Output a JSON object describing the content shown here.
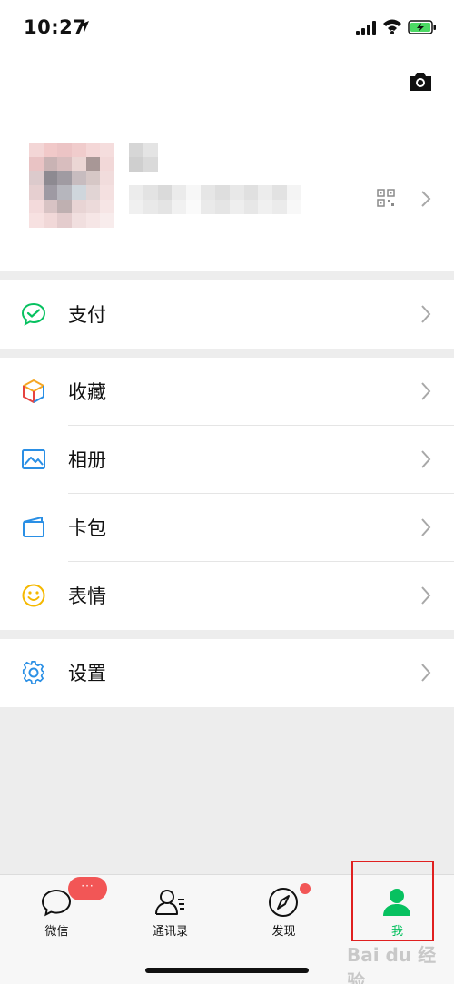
{
  "status_bar": {
    "time": "10:27"
  },
  "menu": {
    "payment": {
      "label": "支付"
    },
    "favorites": {
      "label": "收藏"
    },
    "album": {
      "label": "相册"
    },
    "cards": {
      "label": "卡包"
    },
    "stickers": {
      "label": "表情"
    },
    "settings": {
      "label": "设置"
    }
  },
  "tab_bar": {
    "tabs": [
      {
        "label": "微信",
        "badge": "···"
      },
      {
        "label": "通讯录"
      },
      {
        "label": "发现"
      },
      {
        "label": "我"
      }
    ]
  },
  "watermark": "Bai du 经验",
  "colors": {
    "accent_green": "#07c160",
    "badge_red": "#f25656",
    "highlight_red": "#e02020"
  }
}
